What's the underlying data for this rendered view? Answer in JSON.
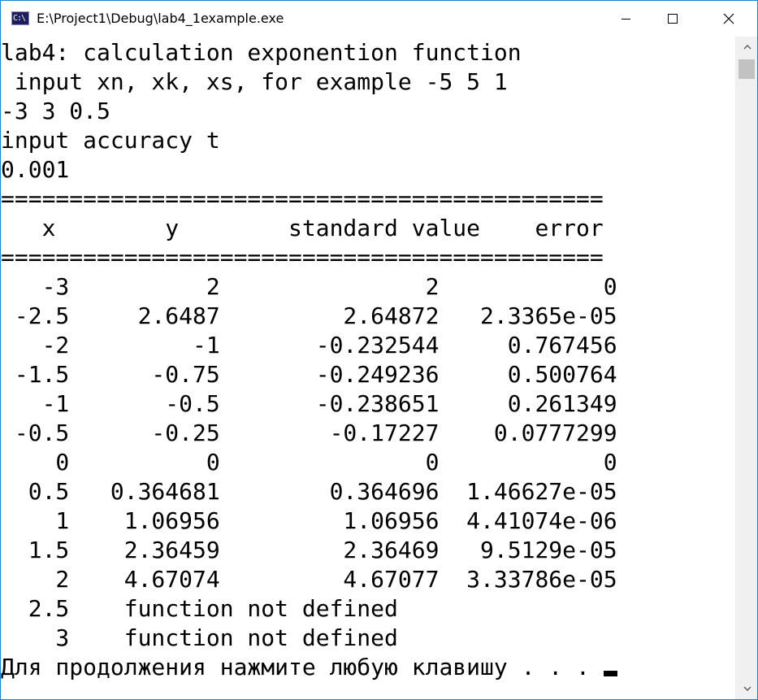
{
  "window": {
    "title": "E:\\Project1\\Debug\\lab4_1example.exe",
    "app_icon_text": "C:\\",
    "border_color": "#1883d7",
    "buttons": {
      "minimize": "minimize-icon",
      "maximize": "maximize-icon",
      "close": "close-icon"
    }
  },
  "console": {
    "lines": [
      "lab4: calculation exponention function",
      " input xn, xk, xs, for example -5 5 1",
      "-3 3 0.5",
      "input accuracy t",
      "0.001",
      "============================================",
      "   x        y        standard value    error",
      "============================================",
      "   -3          2               2            0",
      " -2.5     2.6487         2.64872   2.3365e-05",
      "   -2         -1       -0.232544     0.767456",
      " -1.5      -0.75       -0.249236     0.500764",
      "   -1       -0.5       -0.238651     0.261349",
      " -0.5      -0.25        -0.17227    0.0777299",
      "    0          0               0            0",
      "  0.5   0.364681        0.364696  1.46627e-05",
      "    1    1.06956         1.06956  4.41074e-06",
      "  1.5    2.36459         2.36469   9.5129e-05",
      "    2    4.67074         4.67077  3.33786e-05",
      "  2.5    function not defined",
      "    3    function not defined",
      "Для продолжения нажмите любую клавишу . . . "
    ],
    "text_color": "#000000",
    "background": "#ffffff"
  },
  "scrollbar": {
    "up_icon": "scroll-up-arrow-icon",
    "down_icon": "scroll-down-arrow-icon"
  }
}
